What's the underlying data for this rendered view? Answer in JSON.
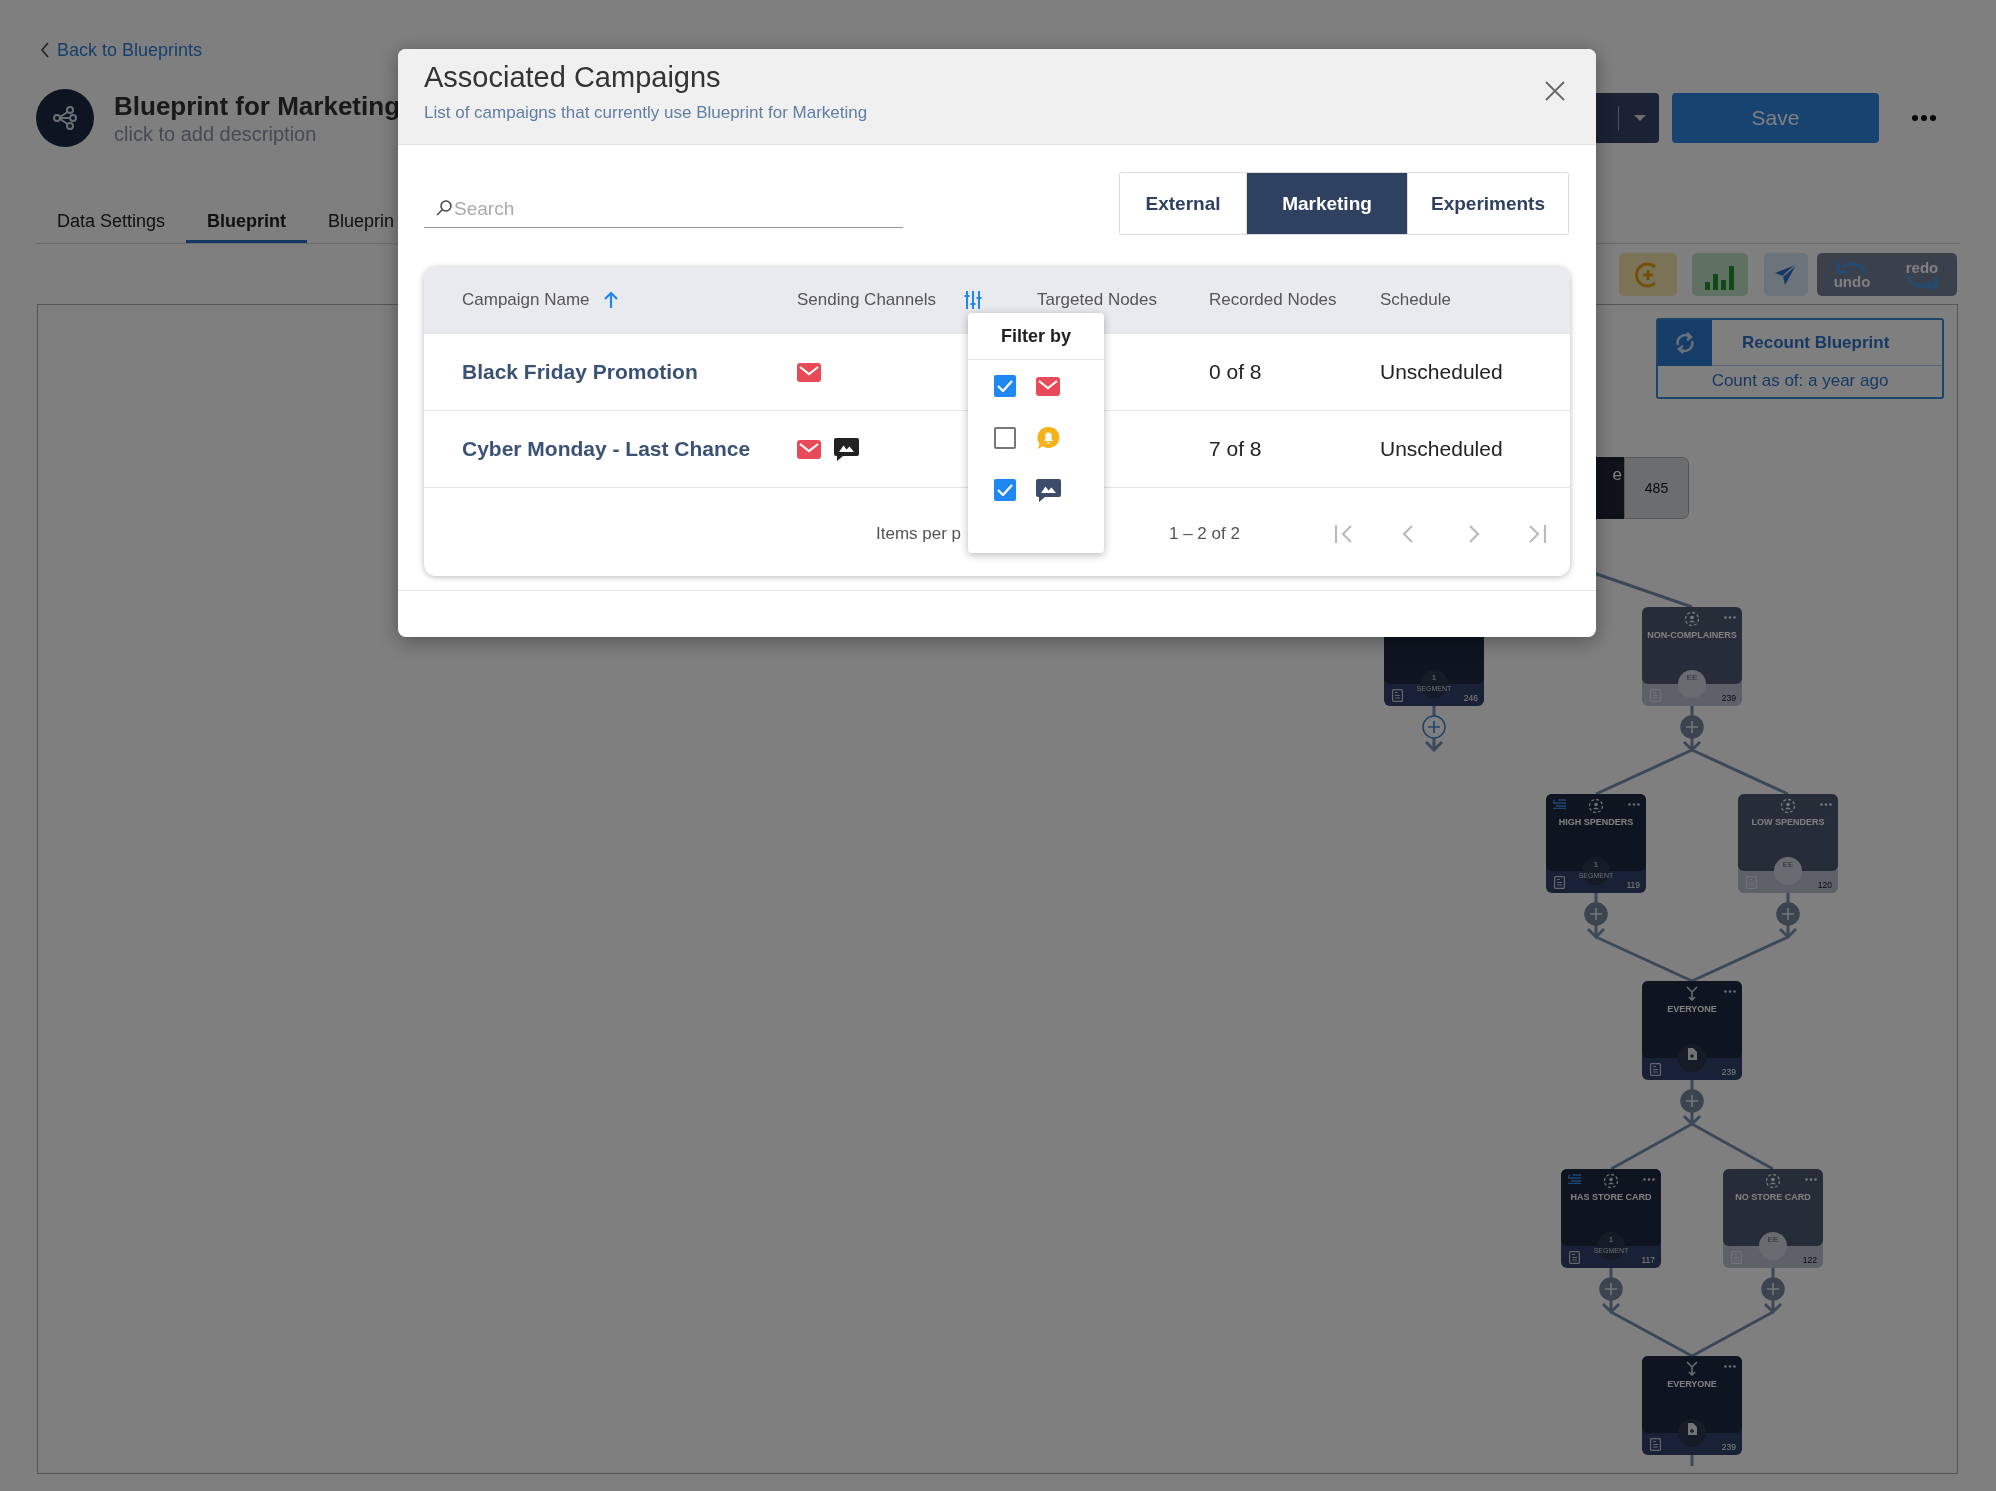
{
  "page": {
    "back_link": "Back to Blueprints",
    "title": "Blueprint for Marketing",
    "description": "click to add description",
    "save_button": "Save",
    "tabs": [
      {
        "label": "Data Settings",
        "selected": false
      },
      {
        "label": "Blueprint",
        "selected": true
      },
      {
        "label": "Blueprin",
        "selected": false
      }
    ],
    "history": {
      "undo": "undo",
      "redo": "redo"
    },
    "recount": {
      "title": "Recount Blueprint",
      "subtitle": "Count as of: a year ago"
    },
    "diagram": {
      "nodes": [
        {
          "kind": "start",
          "title": "e",
          "count": "485"
        },
        {
          "kind": "segment",
          "active": true,
          "badge": "1",
          "badge_caption": "SEGMENT",
          "count": "246",
          "open_end": true
        },
        {
          "kind": "segment",
          "active": false,
          "title": "NON-COMPLAINERS",
          "badge": "EE",
          "count": "239"
        },
        {
          "kind": "segment",
          "active": true,
          "title": "HIGH SPENDERS",
          "badge": "1",
          "badge_caption": "SEGMENT",
          "count": "119"
        },
        {
          "kind": "segment",
          "active": false,
          "title": "LOW SPENDERS",
          "badge": "EE",
          "count": "120"
        },
        {
          "kind": "merge",
          "title": "EVERYONE",
          "count": "239"
        },
        {
          "kind": "segment",
          "active": true,
          "title": "HAS STORE CARD",
          "badge": "1",
          "badge_caption": "SEGMENT",
          "count": "117"
        },
        {
          "kind": "segment",
          "active": false,
          "title": "NO STORE CARD",
          "badge": "EE",
          "count": "122"
        },
        {
          "kind": "merge",
          "title": "EVERYONE",
          "count": "239"
        }
      ]
    }
  },
  "dialog": {
    "title": "Associated Campaigns",
    "subtitle": "List of campaigns that currently use Blueprint for Marketing",
    "search": {
      "placeholder": "Search"
    },
    "tabs": [
      {
        "label": "External",
        "selected": false
      },
      {
        "label": "Marketing",
        "selected": true
      },
      {
        "label": "Experiments",
        "selected": false
      }
    ],
    "table": {
      "columns": [
        {
          "label": "Campaign Name",
          "sorted": true,
          "filterable": false
        },
        {
          "label": "Sending Channels",
          "sorted": false,
          "filterable": true
        },
        {
          "label": "Targeted Nodes",
          "sorted": false,
          "filterable": false
        },
        {
          "label": "Recorded Nodes",
          "sorted": false,
          "filterable": false
        },
        {
          "label": "Schedule",
          "sorted": false,
          "filterable": false
        }
      ],
      "rows": [
        {
          "name": "Black Friday Promotion",
          "channels": [
            {
              "kind": "email"
            }
          ],
          "recorded_nodes": "0 of 8",
          "schedule": "Unscheduled"
        },
        {
          "name": "Cyber Monday - Last Chance",
          "channels": [
            {
              "kind": "email"
            },
            {
              "kind": "image"
            }
          ],
          "recorded_nodes": "7 of 8",
          "schedule": "Unscheduled"
        }
      ]
    },
    "pagination": {
      "items_per_page_label": "Items per p",
      "range": "1 – 2 of 2"
    },
    "filter_popup": {
      "title": "Filter by",
      "options": [
        {
          "kind": "email",
          "checked": true
        },
        {
          "kind": "push",
          "checked": false
        },
        {
          "kind": "image",
          "checked": true
        }
      ]
    }
  }
}
